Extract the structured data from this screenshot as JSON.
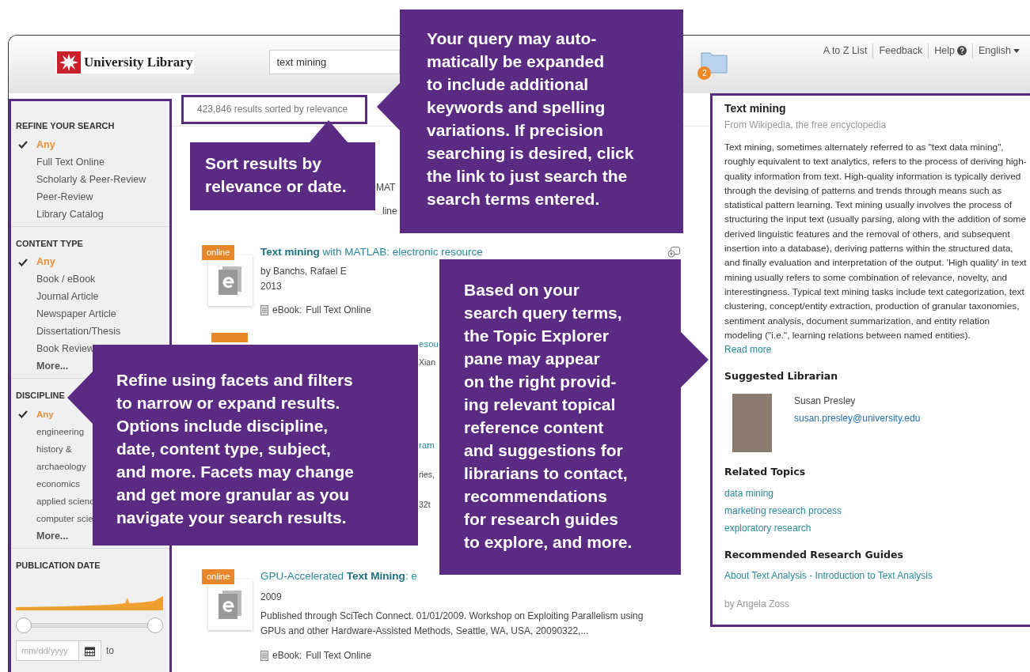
{
  "header": {
    "logo": "University Library",
    "search": {
      "value": "text mining"
    },
    "folder_badge": "2",
    "links": [
      {
        "label": "A to Z List",
        "kind": "plain"
      },
      {
        "label": "Feedback",
        "kind": "plain"
      },
      {
        "label": "Help",
        "kind": "help"
      },
      {
        "label": "English",
        "kind": "dropdown"
      }
    ]
  },
  "sidebar": {
    "sections": [
      {
        "heading": "REFINE YOUR SEARCH",
        "kind": "regular",
        "items": [
          {
            "label": "Any",
            "selected": true
          },
          {
            "label": "Full Text Online",
            "selected": false
          },
          {
            "label": "Scholarly & Peer-Review",
            "selected": false
          },
          {
            "label": "Peer-Review",
            "selected": false
          },
          {
            "label": "Library Catalog",
            "selected": false
          }
        ]
      },
      {
        "heading": "CONTENT TYPE",
        "kind": "regular",
        "items": [
          {
            "label": "Any",
            "selected": true
          },
          {
            "label": "Book / eBook",
            "selected": false
          },
          {
            "label": "Journal Article",
            "selected": false
          },
          {
            "label": "Newspaper Article",
            "selected": false
          },
          {
            "label": "Dissertation/Thesis",
            "selected": false
          },
          {
            "label": "Book Review",
            "selected": false
          }
        ],
        "more": "More..."
      },
      {
        "heading": "DISCIPLINE",
        "kind": "compact",
        "items": [
          {
            "label": "Any",
            "selected": true
          },
          {
            "label": "engineering",
            "selected": false
          },
          {
            "label": "history & archaeology",
            "selected": false
          },
          {
            "label": "economics",
            "selected": false
          },
          {
            "label": "applied scienc",
            "selected": false
          },
          {
            "label": "computer scie",
            "selected": false
          }
        ],
        "more": "More..."
      }
    ],
    "publication_date": {
      "heading": "PUBLICATION DATE",
      "slider": {
        "level": 1
      },
      "from_placeholder": "mm/dd/yyyy",
      "to_label": "to"
    }
  },
  "results_summary": {
    "text": "423,846 results sorted by",
    "sort_link": "relevance"
  },
  "results": [
    {
      "kind": "peek_top",
      "fragments": [
        "MAT",
        "line"
      ]
    },
    {
      "kind": "full",
      "badge": "online",
      "title": "**Text mining** with MATLAB: electronic resource",
      "by": "by",
      "authors": "Banchs, Rafael E",
      "year": "2013",
      "format": "eBook:",
      "access": "Full Text Online",
      "share": true
    },
    {
      "kind": "peek_side",
      "badge_edge": true,
      "fragments": [
        "esou",
        "Xian"
      ]
    },
    {
      "kind": "peek_side",
      "badge_edge": false,
      "fragments": [
        "ram",
        "ries,",
        "32t"
      ]
    },
    {
      "kind": "full",
      "badge": "online",
      "title": "GPU-Accelerated **Text Mining**: e",
      "year": "2009",
      "description": "Published through SciTech Connect. 01/01/2009. Workshop on Exploiting Parallelism using GPUs and other Hardware-Assisted Methods, Seattle, WA, USA, 20090322,...",
      "format": "eBook:",
      "access": "Full Text Online",
      "share": false
    }
  ],
  "topic_pane": {
    "title": "Text mining",
    "source": "From Wikipedia, the free encyclopedia",
    "summary": "Text mining, sometimes alternately referred to as \"text data mining\", roughly equivalent to text analytics, refers to the process of deriving high-quality information from text. High-quality information is typically derived through the devising of patterns and trends through means such as statistical pattern learning. Text mining usually involves the process of structuring the input text (usually parsing, along with the addition of some derived linguistic features and the removal of others, and subsequent insertion into a database), deriving patterns within the structured data, and finally evaluation and interpretation of the output. 'High quality' in text mining usually refers to some combination of relevance, novelty, and interestingness. Typical text mining tasks include text categorization, text clustering, concept/entity extraction, production of granular taxonomies, sentiment analysis, document summarization, and entity relation modeling (\"i.e.\", learning relations between named entities).",
    "read_more": "Read more",
    "librarian": {
      "heading": "Suggested Librarian",
      "name": "Susan Presley",
      "email": "susan.presley@university.edu"
    },
    "related": {
      "heading": "Related Topics",
      "topics": [
        "data mining",
        "marketing research process",
        "exploratory research"
      ]
    },
    "guides": {
      "heading": "Recommended Research Guides",
      "items": [
        "About Text Analysis - Introduction to Text Analysis"
      ],
      "author": "by Angela Zoss"
    }
  },
  "callouts": [
    {
      "kind": "sort",
      "lines": [
        "Sort results by",
        "relevance or date."
      ]
    },
    {
      "kind": "query",
      "lines": [
        "Your query may auto-",
        "matically be expanded",
        "to include additional",
        "keywords and spelling",
        "variations. If precision",
        "searching is desired, click",
        "the link to just search the",
        "search terms entered."
      ]
    },
    {
      "kind": "facets",
      "lines": [
        "Refine using facets and filters",
        "to narrow or expand results.",
        "Options include discipline,",
        "date, content type, subject,",
        "and more. Facets may change",
        "and get more granular as you",
        "navigate your search results."
      ]
    },
    {
      "kind": "topic",
      "lines": [
        "Based on your",
        "search query terms,",
        "the Topic Explorer",
        "pane may appear",
        "on the right provid-",
        "ing relevant topical",
        "reference content",
        "and suggestions for",
        "librarians to contact,",
        "recommendations",
        "for research guides",
        "to explore, and more."
      ]
    }
  ]
}
